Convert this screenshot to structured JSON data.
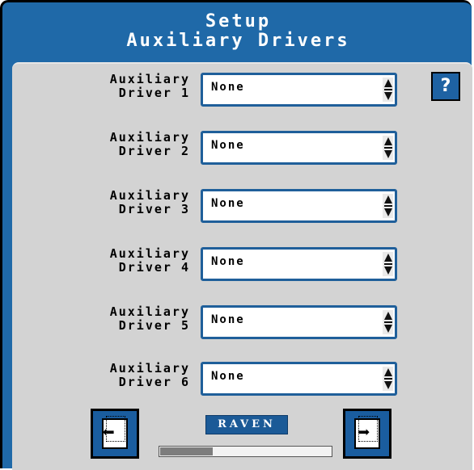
{
  "header": {
    "title_line1": "Setup",
    "title_line2": "Auxiliary Drivers"
  },
  "help": {
    "label": "?"
  },
  "drivers": [
    {
      "label_line1": "Auxiliary",
      "label_line2": "Driver 1",
      "value": "None"
    },
    {
      "label_line1": "Auxiliary",
      "label_line2": "Driver 2",
      "value": "None"
    },
    {
      "label_line1": "Auxiliary",
      "label_line2": "Driver 3",
      "value": "None"
    },
    {
      "label_line1": "Auxiliary",
      "label_line2": "Driver 4",
      "value": "None"
    },
    {
      "label_line1": "Auxiliary",
      "label_line2": "Driver 5",
      "value": "None"
    },
    {
      "label_line1": "Auxiliary",
      "label_line2": "Driver 6",
      "value": "None"
    }
  ],
  "footer": {
    "brand": "RAVEN",
    "progress": 0.31,
    "prev_icon": "page-back-icon",
    "next_icon": "page-forward-icon"
  },
  "colors": {
    "accent": "#1f69a8",
    "panel": "#d3d3d3",
    "field_border": "#1f5f9a"
  }
}
